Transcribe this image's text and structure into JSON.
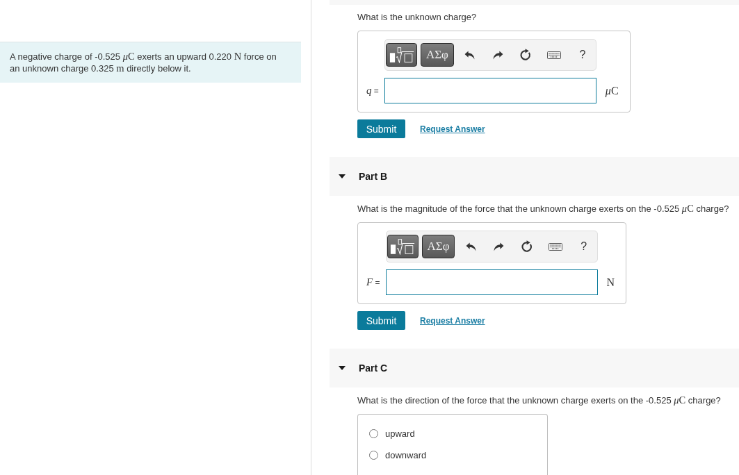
{
  "problem": {
    "runs": [
      {
        "kind": "text",
        "text": "A negative charge of -0.525 "
      },
      {
        "kind": "symbol",
        "text": "μ"
      },
      {
        "kind": "math",
        "text": "C"
      },
      {
        "kind": "text",
        "text": " exerts an upward 0.220 "
      },
      {
        "kind": "math",
        "text": "N"
      },
      {
        "kind": "text",
        "text": " force on an unknown charge 0.325 "
      },
      {
        "kind": "math",
        "text": "m"
      },
      {
        "kind": "text",
        "text": " directly below it."
      }
    ]
  },
  "parts": [
    {
      "question": [
        {
          "kind": "text",
          "text": "What is the unknown charge?"
        }
      ],
      "answer": {
        "kind": "expression",
        "toolbar": {
          "symbols": "ΑΣφ",
          "help": "?"
        },
        "label": "*q* =",
        "unit": [
          {
            "kind": "symbol",
            "text": "μ"
          },
          {
            "kind": "math",
            "text": "C"
          }
        ]
      },
      "actions": {
        "submit": "Submit",
        "request": "Request Answer"
      }
    },
    {
      "title": "Part B",
      "expanded": true,
      "question": [
        {
          "kind": "text",
          "text": "What is the magnitude of the force that the unknown charge exerts on the -0.525 "
        },
        {
          "kind": "symbol",
          "text": "μ"
        },
        {
          "kind": "math",
          "text": "C"
        },
        {
          "kind": "text",
          "text": " charge?"
        }
      ],
      "answer": {
        "kind": "expression",
        "toolbar": {
          "symbols": "ΑΣφ",
          "help": "?"
        },
        "label": "*F* =",
        "unit": [
          {
            "kind": "math",
            "text": "N"
          }
        ]
      },
      "actions": {
        "submit": "Submit",
        "request": "Request Answer"
      }
    },
    {
      "title": "Part C",
      "expanded": true,
      "question": [
        {
          "kind": "text",
          "text": "What is the direction of the force that the unknown charge exerts on the -0.525 "
        },
        {
          "kind": "symbol",
          "text": "μ"
        },
        {
          "kind": "math",
          "text": "C"
        },
        {
          "kind": "text",
          "text": " charge?"
        }
      ],
      "answer": {
        "kind": "choice",
        "options": [
          {
            "label": "upward",
            "selected": false
          },
          {
            "label": "downward",
            "selected": false
          }
        ]
      }
    }
  ]
}
